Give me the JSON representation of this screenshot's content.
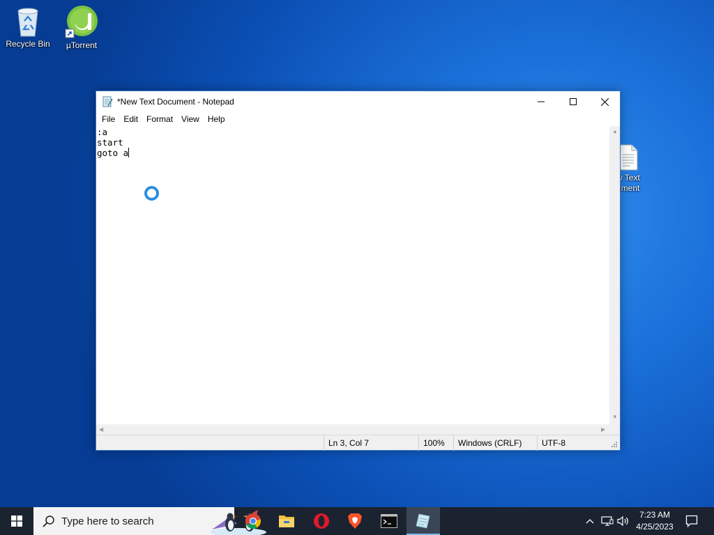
{
  "desktop": {
    "icons": [
      {
        "label": "Recycle Bin"
      },
      {
        "label": "µTorrent"
      },
      {
        "label": "w Text\nument"
      }
    ]
  },
  "notepad": {
    "title": "*New Text Document - Notepad",
    "menu": [
      "File",
      "Edit",
      "Format",
      "View",
      "Help"
    ],
    "content_lines": [
      ":a",
      "start",
      "goto a"
    ],
    "status": {
      "position": "Ln 3, Col 7",
      "zoom": "100%",
      "line_ending": "Windows (CRLF)",
      "encoding": "UTF-8"
    }
  },
  "taskbar": {
    "search_placeholder": "Type here to search",
    "pinned": [
      "chrome-icon",
      "file-explorer-icon",
      "opera-icon",
      "brave-icon",
      "cmd-icon",
      "notepad-icon"
    ],
    "clock": {
      "time": "7:23 AM",
      "date": "4/25/2023"
    }
  },
  "colors": {
    "accent": "#0078d7",
    "taskbar": "#1b2331"
  }
}
